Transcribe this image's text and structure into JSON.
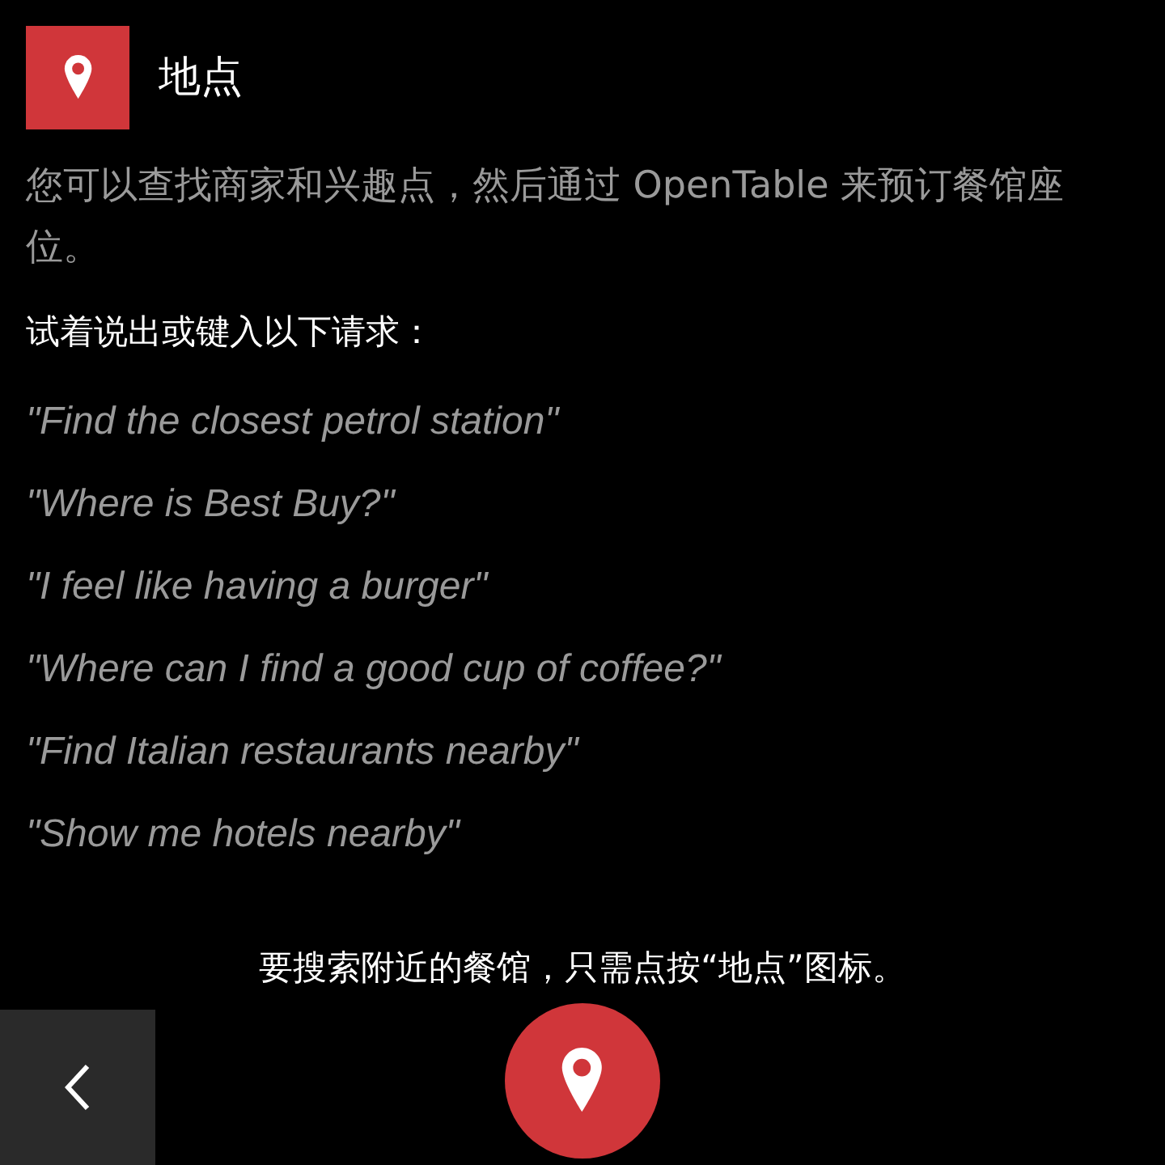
{
  "header": {
    "title": "地点"
  },
  "description": "您可以查找商家和兴趣点，然后通过 OpenTable 来预订餐馆座位。",
  "prompt": "试着说出或键入以下请求：",
  "examples": [
    "\"Find the closest petrol station\"",
    "\"Where is Best Buy?\"",
    "\"I feel like having a burger\"",
    "\"Where can I find a good cup of coffee?\"",
    "\"Find Italian restaurants nearby\"",
    "\"Show me hotels nearby\""
  ],
  "hint": "要搜索附近的餐馆，只需点按“地点”图标。"
}
